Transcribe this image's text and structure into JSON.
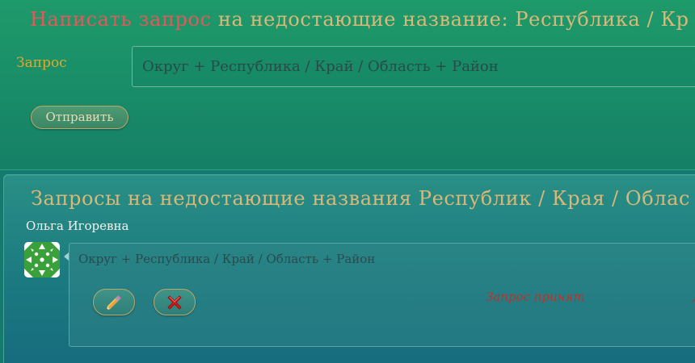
{
  "request_form": {
    "title_accent": "Написать запрос",
    "title_rest": "на недостающие название: Республика / Кр",
    "label": "Запрос",
    "input_value": "Округ + Республика / Край / Область + Район",
    "submit_label": "Отправить"
  },
  "requests_list": {
    "title": "Запросы на недостающие названия Республик / Края / Облас",
    "items": [
      {
        "author": "Ольга Игоревна",
        "text": "Округ + Республика / Край / Область + Район",
        "status": "Запрос принят",
        "status_extra": "Д",
        "edit_icon": "pencil-icon",
        "delete_icon": "red-x-icon"
      }
    ]
  },
  "colors": {
    "accent_red": "#e05a5a",
    "title_gold": "#d9b878",
    "label_orange": "#e3a72a",
    "status_red": "#c0302a"
  }
}
